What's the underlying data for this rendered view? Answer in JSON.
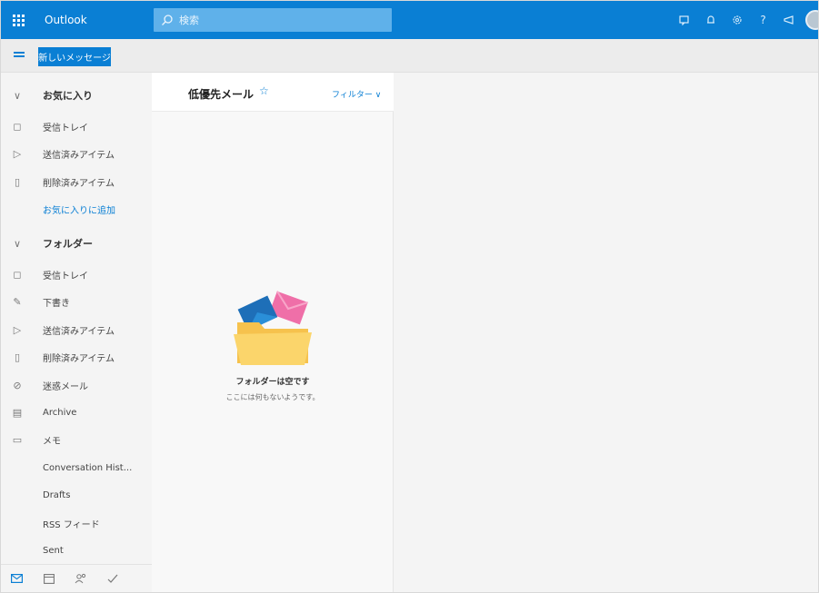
{
  "topbar": {
    "app_title": "Outlook",
    "search_placeholder": "検索",
    "icons": [
      "waffle-icon",
      "search-icon",
      "skype-icon",
      "bell-icon",
      "gear-icon",
      "help-icon",
      "feedback-icon",
      "avatar"
    ],
    "help_glyph": "?"
  },
  "cmdbar": {
    "new_message_label": "新しいメッセージ"
  },
  "sidebar": {
    "favorites_header": "お気に入り",
    "favorites": [
      {
        "label": "受信トレイ",
        "icon": "inbox-icon"
      },
      {
        "label": "送信済みアイテム",
        "icon": "send-icon"
      },
      {
        "label": "削除済みアイテム",
        "icon": "trash-icon"
      }
    ],
    "add_favorite": "お気に入りに追加",
    "folders_header": "フォルダー",
    "folders": [
      {
        "label": "受信トレイ",
        "icon": "inbox-icon"
      },
      {
        "label": "下書き",
        "icon": "pencil-icon"
      },
      {
        "label": "送信済みアイテム",
        "icon": "send-icon"
      },
      {
        "label": "削除済みアイテム",
        "icon": "trash-icon"
      },
      {
        "label": "迷惑メール",
        "icon": "block-icon"
      },
      {
        "label": "Archive",
        "icon": "archive-icon"
      },
      {
        "label": "メモ",
        "icon": "note-icon"
      },
      {
        "label": "Conversation Hist...",
        "icon": ""
      },
      {
        "label": "Drafts",
        "icon": ""
      },
      {
        "label": "RSS フィード",
        "icon": ""
      },
      {
        "label": "Sent",
        "icon": ""
      }
    ],
    "bottom_icons": [
      "mail-icon",
      "calendar-icon",
      "people-icon",
      "tasks-icon"
    ]
  },
  "message_list": {
    "title": "低優先メール",
    "filter_label": "フィルター",
    "empty_title": "フォルダーは空です",
    "empty_subtitle": "ここには何もないようです。"
  },
  "colors": {
    "accent": "#0a7fd4"
  }
}
